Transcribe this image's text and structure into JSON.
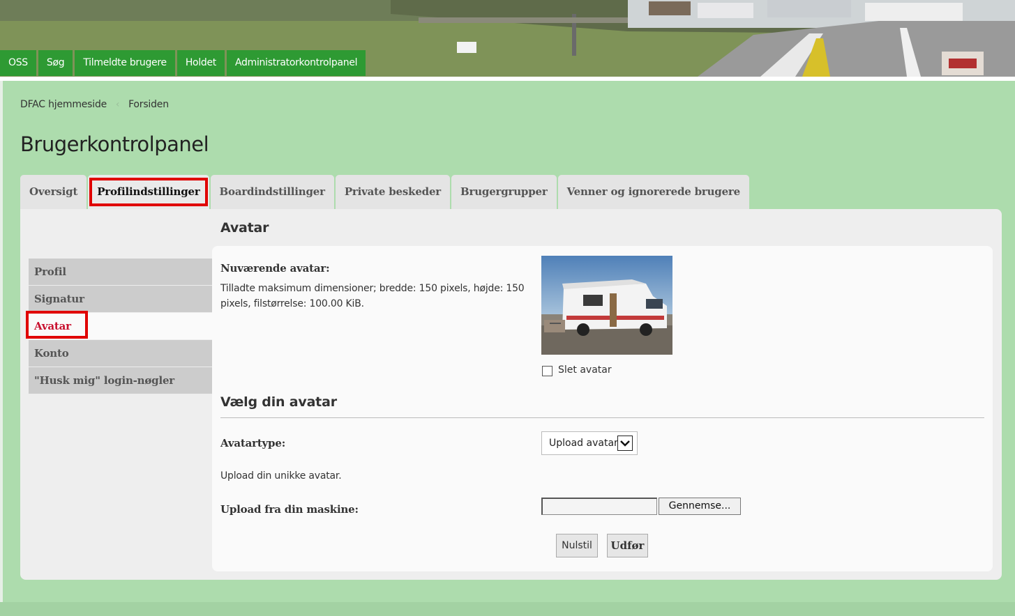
{
  "nav": {
    "items": [
      "OSS",
      "Søg",
      "Tilmeldte brugere",
      "Holdet",
      "Administratorkontrolpanel"
    ]
  },
  "breadcrumb": {
    "home": "DFAC hjemmeside",
    "forum": "Forsiden"
  },
  "page": {
    "title": "Brugerkontrolpanel"
  },
  "tabs": [
    {
      "label": "Oversigt"
    },
    {
      "label": "Profilindstillinger"
    },
    {
      "label": "Boardindstillinger"
    },
    {
      "label": "Private beskeder"
    },
    {
      "label": "Brugergrupper"
    },
    {
      "label": "Venner og ignorerede brugere"
    }
  ],
  "subnav": [
    {
      "label": "Profil"
    },
    {
      "label": "Signatur"
    },
    {
      "label": "Avatar"
    },
    {
      "label": "Konto"
    },
    {
      "label": "\"Husk mig\" login-nøgler"
    }
  ],
  "avatar": {
    "heading": "Avatar",
    "current_label": "Nuværende avatar:",
    "explain_line1": "Tilladte maksimum dimensioner; bredde: 150 pixels, højde: 150",
    "explain_line2": "pixels, filstørrelse: 100.00 KiB.",
    "delete_label": "Slet avatar"
  },
  "choose": {
    "heading": "Vælg din avatar",
    "type_label": "Avatartype:",
    "type_value": "Upload avatar",
    "upload_explain": "Upload din unikke avatar.",
    "upload_label": "Upload fra din maskine:",
    "browse_label": "Gennemse...",
    "reset_label": "Nulstil",
    "submit_label": "Udfør"
  },
  "colors": {
    "nav_bg": "#2e9a33",
    "page_bg": "#addcad",
    "highlight": "#e00000",
    "active_link": "#c8102e"
  }
}
